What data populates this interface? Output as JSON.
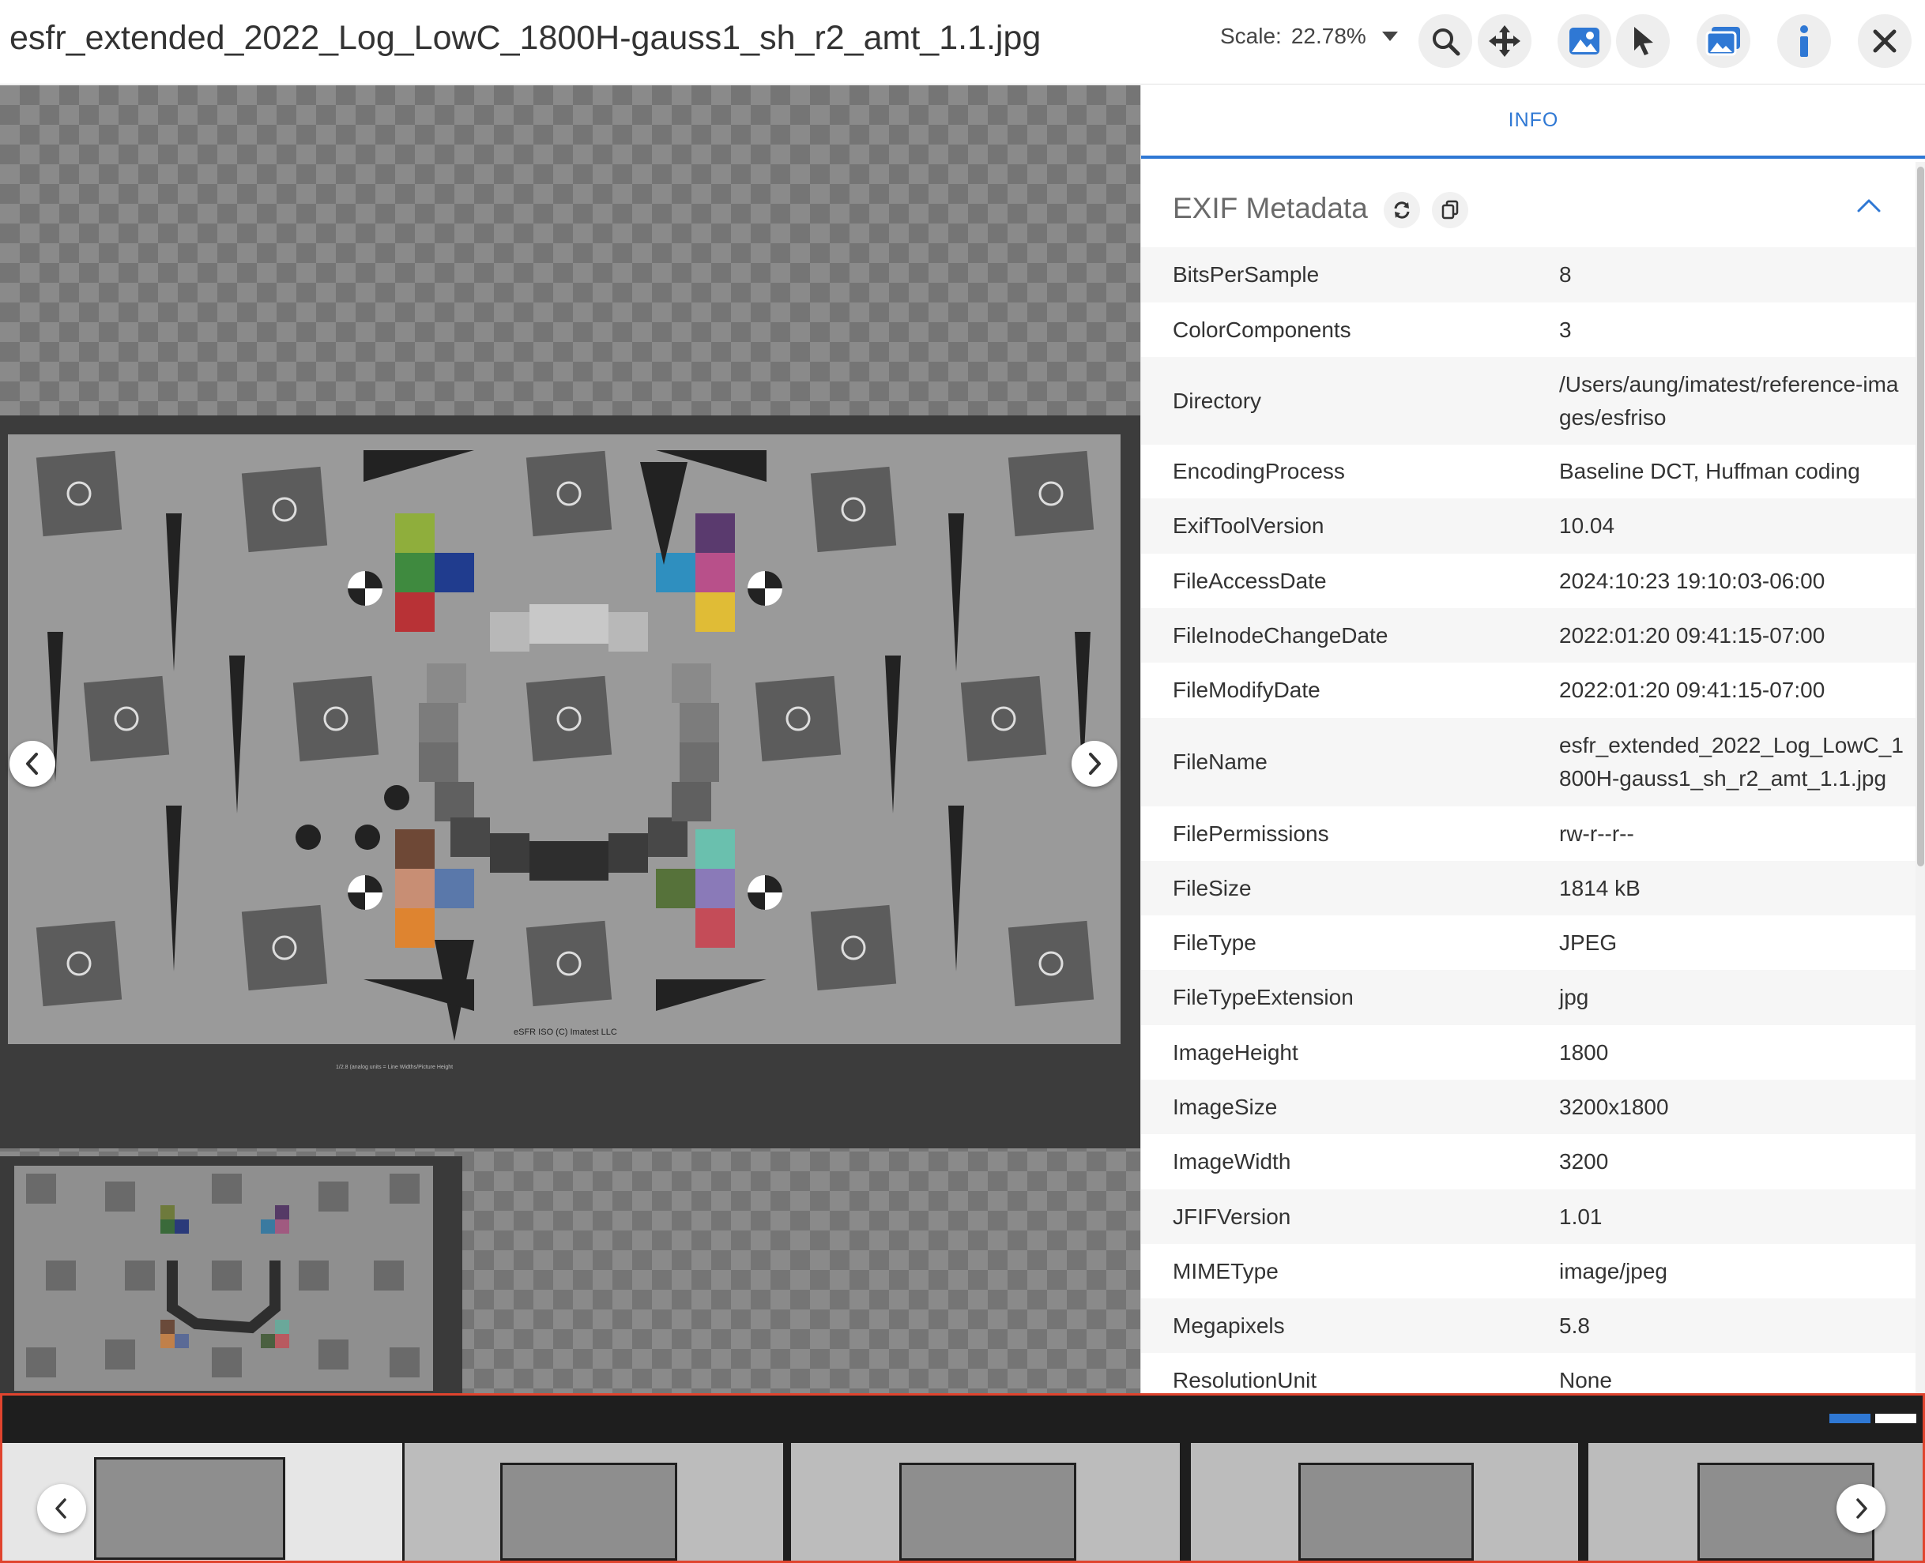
{
  "header": {
    "filename": "esfr_extended_2022_Log_LowC_1800H-gauss1_sh_r2_amt_1.1.jpg",
    "scale_label": "Scale:",
    "scale_value": "22.78%",
    "tools": [
      "search-icon",
      "move-icon",
      "image-icon",
      "pointer-icon",
      "gallery-icon",
      "info-icon",
      "close-icon"
    ]
  },
  "viewer": {
    "chart_caption": "eSFR ISO (C) Imatest LLC",
    "chart_footnote": "1/2.8 (analog units = Line Widths/Picture Height"
  },
  "panel": {
    "tab_label": "INFO",
    "section_title": "EXIF Metadata",
    "rows": [
      {
        "key": "BitsPerSample",
        "value": "8"
      },
      {
        "key": "ColorComponents",
        "value": "3"
      },
      {
        "key": "Directory",
        "value": "/Users/aung/imatest/reference-images/esfriso"
      },
      {
        "key": "EncodingProcess",
        "value": "Baseline DCT, Huffman coding"
      },
      {
        "key": "ExifToolVersion",
        "value": "10.04"
      },
      {
        "key": "FileAccessDate",
        "value": "2024:10:23 19:10:03-06:00"
      },
      {
        "key": "FileInodeChangeDate",
        "value": "2022:01:20 09:41:15-07:00"
      },
      {
        "key": "FileModifyDate",
        "value": "2022:01:20 09:41:15-07:00"
      },
      {
        "key": "FileName",
        "value": "esfr_extended_2022_Log_LowC_1800H-gauss1_sh_r2_amt_1.1.jpg"
      },
      {
        "key": "FilePermissions",
        "value": "rw-r--r--"
      },
      {
        "key": "FileSize",
        "value": "1814 kB"
      },
      {
        "key": "FileType",
        "value": "JPEG"
      },
      {
        "key": "FileTypeExtension",
        "value": "jpg"
      },
      {
        "key": "ImageHeight",
        "value": "1800"
      },
      {
        "key": "ImageSize",
        "value": "3200x1800"
      },
      {
        "key": "ImageWidth",
        "value": "3200"
      },
      {
        "key": "JFIFVersion",
        "value": "1.01"
      },
      {
        "key": "MIMEType",
        "value": "image/jpeg"
      },
      {
        "key": "Megapixels",
        "value": "5.8"
      },
      {
        "key": "ResolutionUnit",
        "value": "None"
      }
    ]
  },
  "filmstrip": {
    "thumbnail_count": 5,
    "active_index": 0
  },
  "colors": {
    "accent": "#2f78d4",
    "filmstrip_border": "#e0442e"
  }
}
